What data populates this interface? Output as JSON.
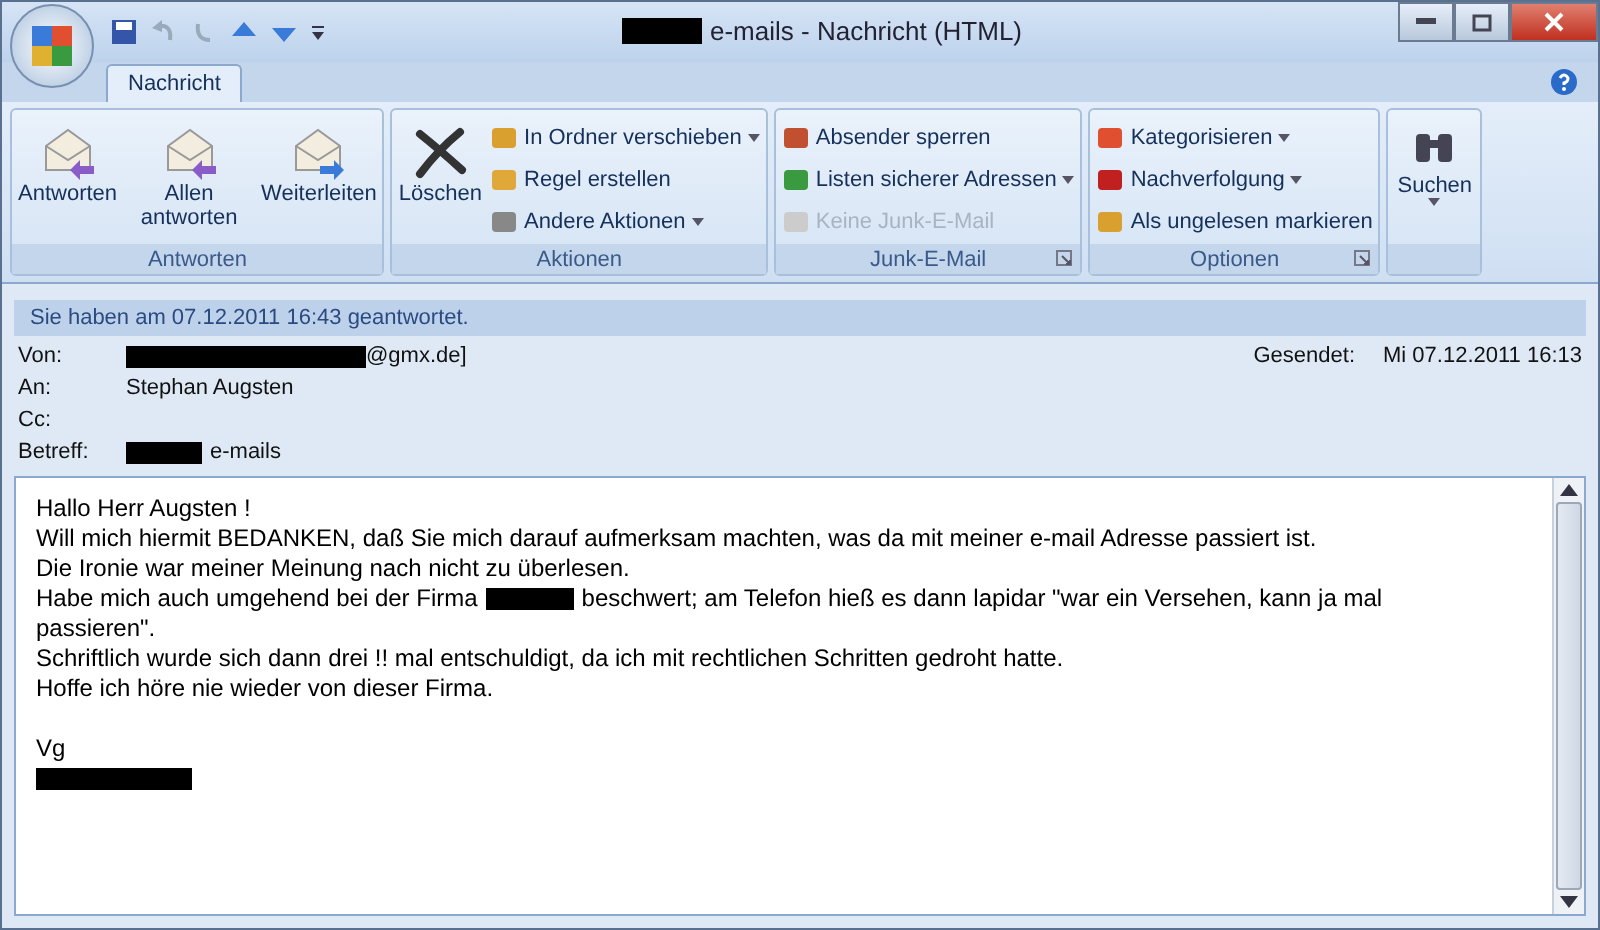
{
  "window": {
    "title_suffix": "e-mails - Nachricht (HTML)"
  },
  "tabs": [
    {
      "label": "Nachricht",
      "selected": true
    }
  ],
  "ribbon": [
    {
      "name": "Antworten",
      "items": [
        {
          "kind": "large",
          "label": "Antworten"
        },
        {
          "kind": "large",
          "label": "Allen antworten"
        },
        {
          "kind": "large",
          "label": "Weiterleiten"
        }
      ]
    },
    {
      "name": "Aktionen",
      "items": [
        {
          "kind": "large",
          "label": "Löschen"
        },
        {
          "kind": "small",
          "label": "In Ordner verschieben",
          "dropdown": true
        },
        {
          "kind": "small",
          "label": "Regel erstellen"
        },
        {
          "kind": "small",
          "label": "Andere Aktionen",
          "dropdown": true
        }
      ]
    },
    {
      "name": "Junk-E-Mail",
      "launcher": true,
      "items": [
        {
          "kind": "small",
          "label": "Absender sperren"
        },
        {
          "kind": "small",
          "label": "Listen sicherer Adressen",
          "dropdown": true
        },
        {
          "kind": "small",
          "label": "Keine Junk-E-Mail",
          "disabled": true
        }
      ]
    },
    {
      "name": "Optionen",
      "launcher": true,
      "items": [
        {
          "kind": "small",
          "label": "Kategorisieren",
          "dropdown": true
        },
        {
          "kind": "small",
          "label": "Nachverfolgung",
          "dropdown": true
        },
        {
          "kind": "small",
          "label": "Als ungelesen markieren"
        }
      ]
    },
    {
      "items": [
        {
          "kind": "large",
          "label": "Suchen",
          "dropdown": true
        }
      ]
    }
  ],
  "info_bar": "Sie haben am 07.12.2011 16:43 geantwortet.",
  "header": {
    "from_label": "Von:",
    "from_value": "@gmx.de]",
    "to_label": "An:",
    "to_value": "Stephan Augsten",
    "cc_label": "Cc:",
    "subject_label": "Betreff:",
    "subject_value": "e-mails",
    "sent_label": "Gesendet:",
    "sent_value": "Mi 07.12.2011 16:13"
  },
  "body": [
    [
      {
        "kind": "text",
        "text": "Hallo Herr Augsten !"
      }
    ],
    [
      {
        "kind": "text",
        "text": "Will mich hiermit BEDANKEN, daß Sie mich darauf aufmerksam machten, was da mit meiner e-mail Adresse passiert ist."
      }
    ],
    [
      {
        "kind": "text",
        "text": "Die Ironie war meiner Meinung nach nicht zu überlesen."
      }
    ],
    [
      {
        "kind": "text",
        "text": "Habe mich auch umgehend bei der Firma"
      },
      {
        "kind": "redaction"
      },
      {
        "kind": "text",
        "text": "beschwert; am Telefon hieß es dann lapidar \"war ein Versehen, kann ja mal"
      }
    ],
    [
      {
        "kind": "text",
        "text": "passieren\"."
      }
    ],
    [
      {
        "kind": "text",
        "text": "Schriftlich wurde sich dann drei !! mal entschuldigt, da ich mit rechtlichen Schritten gedroht hatte."
      }
    ],
    [
      {
        "kind": "text",
        "text": "Hoffe ich höre nie wieder von dieser Firma."
      }
    ],
    [
      {
        "kind": "blank"
      }
    ],
    [
      {
        "kind": "text",
        "text": "Vg"
      }
    ],
    [
      {
        "kind": "redaction",
        "wide": true
      }
    ]
  ]
}
